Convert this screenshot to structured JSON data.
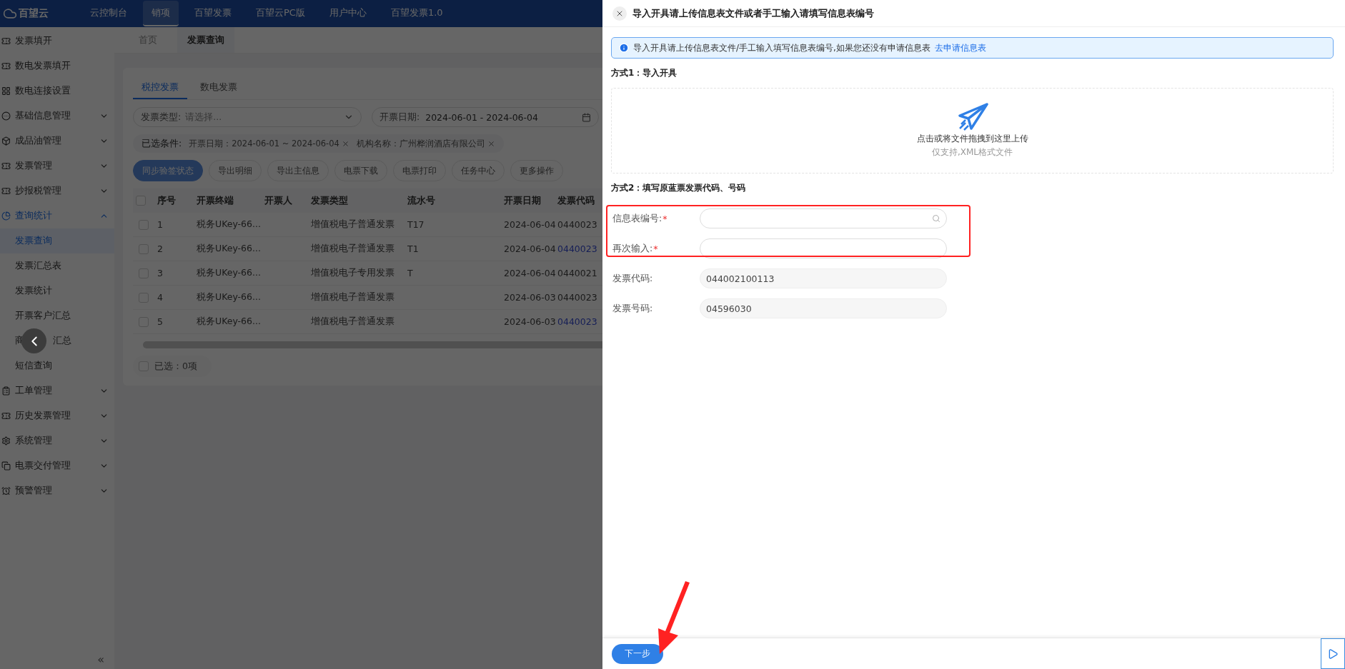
{
  "top_nav": {
    "logo": "百望云",
    "tabs": [
      {
        "label": "云控制台",
        "selected": false
      },
      {
        "label": "销项",
        "selected": true
      },
      {
        "label": "百望发票",
        "selected": false
      },
      {
        "label": "百望云PC版",
        "selected": false
      },
      {
        "label": "用户中心",
        "selected": false
      },
      {
        "label": "百望发票1.0",
        "selected": false
      }
    ]
  },
  "sidebar": {
    "items": [
      {
        "label": "发票填开"
      },
      {
        "label": "数电发票填开"
      },
      {
        "label": "数电连接设置"
      },
      {
        "label": "基础信息管理",
        "expanded": false
      },
      {
        "label": "成品油管理",
        "expanded": false
      },
      {
        "label": "发票管理",
        "expanded": false
      },
      {
        "label": "抄报税管理",
        "expanded": false
      },
      {
        "label": "查询统计",
        "expanded": true,
        "children": [
          {
            "label": "发票查询",
            "selected": true
          },
          {
            "label": "发票汇总表",
            "selected": false
          },
          {
            "label": "发票统计",
            "selected": false
          },
          {
            "label": "开票客户汇总",
            "selected": false
          },
          {
            "label": "商",
            "label_tail": "汇总",
            "selected": false
          },
          {
            "label": "短信查询",
            "selected": false
          }
        ]
      },
      {
        "label": "工单管理",
        "expanded": false
      },
      {
        "label": "历史发票管理",
        "expanded": false
      },
      {
        "label": "系统管理",
        "expanded": false
      },
      {
        "label": "电票交付管理",
        "expanded": false
      },
      {
        "label": "预警管理",
        "expanded": false
      }
    ],
    "collapse": "«"
  },
  "breadcrumb_tabs": [
    {
      "label": "首页",
      "selected": false
    },
    {
      "label": "发票查询",
      "selected": true
    }
  ],
  "sub_tabs": [
    {
      "label": "税控发票",
      "selected": true
    },
    {
      "label": "数电发票",
      "selected": false
    }
  ],
  "filters": {
    "invoice_type": {
      "label": "发票类型:",
      "placeholder": "请选择..."
    },
    "date": {
      "label": "开票日期:",
      "value": "2024-06-01 - 2024-06-04"
    }
  },
  "conditions": {
    "label": "已选条件:",
    "tags": [
      "开票日期：2024-06-01 ~ 2024-06-04",
      "机构名称：广州桦润酒店有限公司"
    ]
  },
  "actions": [
    {
      "label": "同步验签状态",
      "primary": true
    },
    {
      "label": "导出明细",
      "primary": false
    },
    {
      "label": "导出主信息",
      "primary": false
    },
    {
      "label": "电票下载",
      "primary": false
    },
    {
      "label": "电票打印",
      "primary": false
    },
    {
      "label": "任务中心",
      "primary": false
    },
    {
      "label": "更多操作",
      "primary": false
    }
  ],
  "table": {
    "all_checked": false,
    "columns": [
      "序号",
      "开票终端",
      "开票人",
      "发票类型",
      "流水号",
      "开票日期",
      "发票代码"
    ],
    "rows": [
      {
        "checked": false,
        "seq": "1",
        "terminal": "税务UKey-66...",
        "type": "增值税电子普通发票",
        "serial": "T17",
        "date": "2024-06-04",
        "code": "0440023",
        "code_link": false
      },
      {
        "checked": false,
        "seq": "2",
        "terminal": "税务UKey-66...",
        "type": "增值税电子普通发票",
        "serial": "T1",
        "date": "2024-06-04",
        "code": "0440023",
        "code_link": true
      },
      {
        "checked": false,
        "seq": "3",
        "terminal": "税务UKey-66...",
        "type": "增值税电子专用发票",
        "serial": "T",
        "date": "2024-06-04",
        "code": "0440021",
        "code_link": false
      },
      {
        "checked": false,
        "seq": "4",
        "terminal": "税务UKey-66...",
        "type": "增值税电子普通发票",
        "date": "2024-06-03",
        "code": "0440023",
        "code_link": false
      },
      {
        "checked": false,
        "seq": "5",
        "terminal": "税务UKey-66...",
        "type": "增值税电子普通发票",
        "date": "2024-06-03",
        "code": "0440023",
        "code_link": true
      }
    ]
  },
  "selection": {
    "text": "已选：0项",
    "checked": false
  },
  "drawer": {
    "title": "导入开具请上传信息表文件或者手工输入请填写信息表编号",
    "alert": {
      "text": "导入开具请上传信息表文件/手工输入填写信息表编号,如果您还没有申请信息表",
      "link": "去申请信息表"
    },
    "section_1": "方式1：导入开具",
    "upload": {
      "text": "点击或将文件拖拽到这里上传",
      "hint": "仅支持,XML格式文件"
    },
    "section_2": "方式2：填写原蓝票发票代码、号码",
    "fields": [
      {
        "label": "信息表编号:",
        "required_mark": "*",
        "search": true,
        "disabled": false
      },
      {
        "label": "再次输入:",
        "required_mark": "*",
        "disabled": false
      },
      {
        "label": "发票代码:",
        "disabled": true,
        "value": "044002100113"
      },
      {
        "label": "发票号码:",
        "disabled": true,
        "value": "04596030"
      }
    ],
    "next_button": "下一步"
  }
}
